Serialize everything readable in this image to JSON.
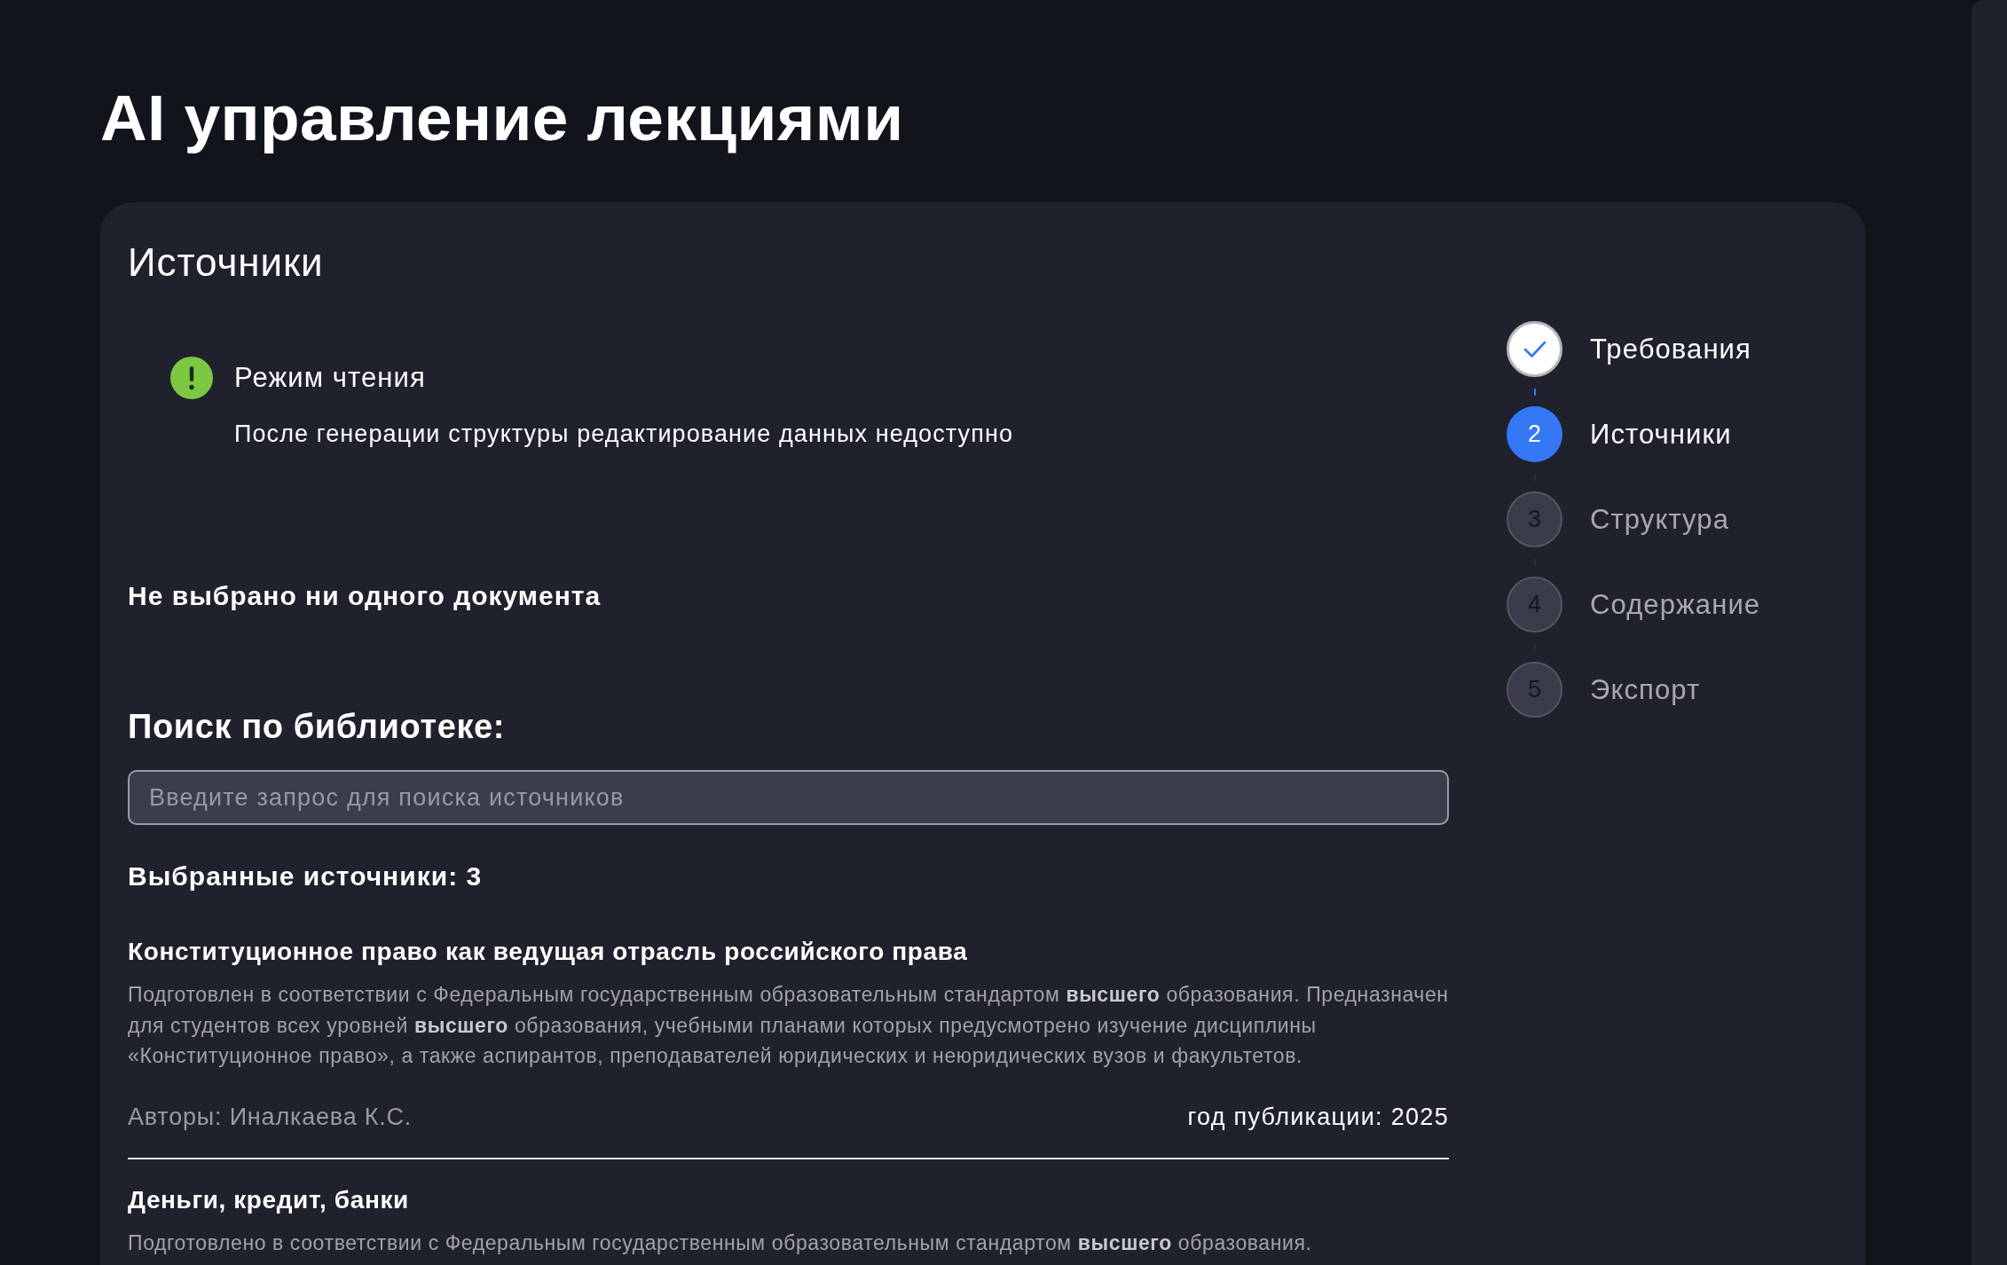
{
  "page": {
    "title": "AI управление лекциями"
  },
  "card": {
    "title": "Источники",
    "alert": {
      "title": "Режим чтения",
      "message": "После генерации структуры редактирование данных недоступно"
    },
    "selection_status": "Не выбрано ни одного документа",
    "search": {
      "label": "Поиск по библиотеке:",
      "placeholder": "Введите запрос для поиска источников"
    },
    "selected_count": "Выбранные источники: 3",
    "sources": [
      {
        "title": "Конституционное право как ведущая отрасль российского права",
        "description": "Подготовлен в соответствии с Федеральным государственным образовательным стандартом **высшего** образования. Предназначен для студентов всех уровней **высшего** образования, учебными планами которых предусмотрено изучение дисциплины «Конституционное право», а также аспирантов, преподавателей юридических и неюридических вузов и факультетов.",
        "authors": "Авторы: Иналкаева К.С.",
        "year": "год публикации: 2025"
      },
      {
        "title": "Деньги, кредит, банки",
        "description": "Подготовлено в соответствии с Федеральным государственным образовательным стандартом **высшего** образования."
      }
    ]
  },
  "stepper": {
    "steps": [
      {
        "label": "Требования",
        "completed": true,
        "selected": false
      },
      {
        "number": "2",
        "label": "Источники",
        "completed": false,
        "selected": true
      },
      {
        "number": "3",
        "label": "Структура",
        "completed": false,
        "selected": false
      },
      {
        "number": "4",
        "label": "Содержание",
        "completed": false,
        "selected": false
      },
      {
        "number": "5",
        "label": "Экспорт",
        "completed": false,
        "selected": false
      }
    ]
  }
}
